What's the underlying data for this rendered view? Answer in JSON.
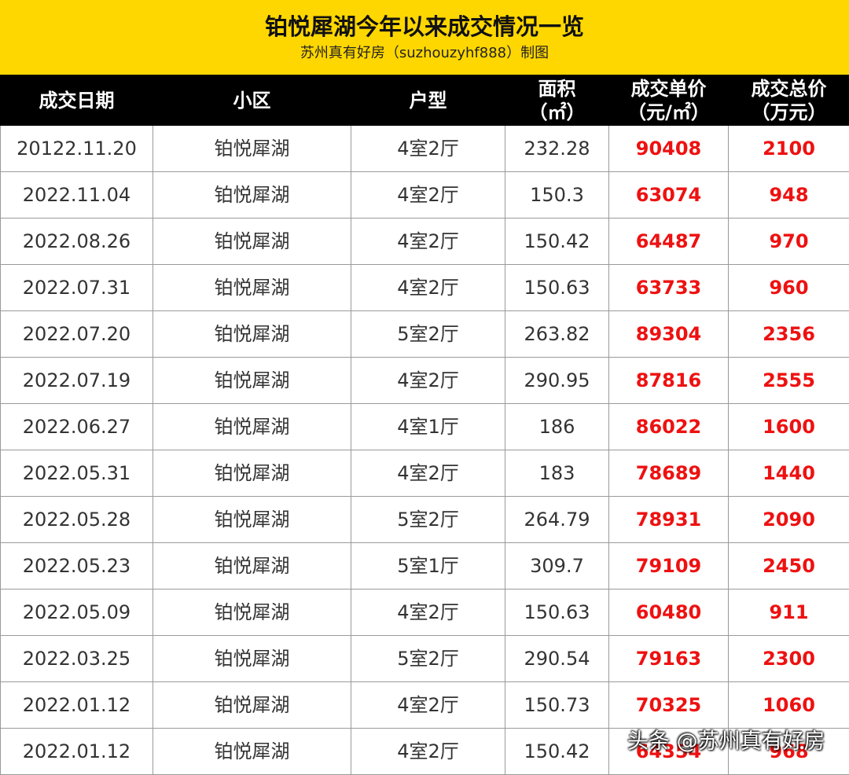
{
  "banner": {
    "title": "铂悦犀湖今年以来成交情况一览",
    "subtitle": "苏州真有好房（suzhouzyhf888）制图"
  },
  "colors": {
    "banner_bg": "#ffd700",
    "header_bg": "#000000",
    "price_text": "#ee1111"
  },
  "table": {
    "headers": [
      [
        "成交日期"
      ],
      [
        "小区"
      ],
      [
        "户型"
      ],
      [
        "面积",
        "（㎡）"
      ],
      [
        "成交单价",
        "（元/㎡）"
      ],
      [
        "成交总价",
        "（万元）"
      ]
    ],
    "rows": [
      [
        "20122.11.20",
        "铂悦犀湖",
        "4室2厅",
        "232.28",
        "90408",
        "2100"
      ],
      [
        "2022.11.04",
        "铂悦犀湖",
        "4室2厅",
        "150.3",
        "63074",
        "948"
      ],
      [
        "2022.08.26",
        "铂悦犀湖",
        "4室2厅",
        "150.42",
        "64487",
        "970"
      ],
      [
        "2022.07.31",
        "铂悦犀湖",
        "4室2厅",
        "150.63",
        "63733",
        "960"
      ],
      [
        "2022.07.20",
        "铂悦犀湖",
        "5室2厅",
        "263.82",
        "89304",
        "2356"
      ],
      [
        "2022.07.19",
        "铂悦犀湖",
        "4室2厅",
        "290.95",
        "87816",
        "2555"
      ],
      [
        "2022.06.27",
        "铂悦犀湖",
        "4室1厅",
        "186",
        "86022",
        "1600"
      ],
      [
        "2022.05.31",
        "铂悦犀湖",
        "4室2厅",
        "183",
        "78689",
        "1440"
      ],
      [
        "2022.05.28",
        "铂悦犀湖",
        "5室2厅",
        "264.79",
        "78931",
        "2090"
      ],
      [
        "2022.05.23",
        "铂悦犀湖",
        "5室1厅",
        "309.7",
        "79109",
        "2450"
      ],
      [
        "2022.05.09",
        "铂悦犀湖",
        "4室2厅",
        "150.63",
        "60480",
        "911"
      ],
      [
        "2022.03.25",
        "铂悦犀湖",
        "5室2厅",
        "290.54",
        "79163",
        "2300"
      ],
      [
        "2022.01.12",
        "铂悦犀湖",
        "4室2厅",
        "150.73",
        "70325",
        "1060"
      ],
      [
        "2022.01.12",
        "铂悦犀湖",
        "4室2厅",
        "150.42",
        "64354",
        "968"
      ]
    ]
  },
  "watermark": {
    "text": "头条 @苏州真有好房"
  }
}
